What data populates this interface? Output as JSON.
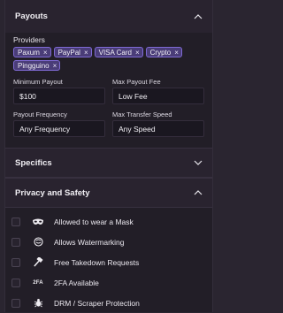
{
  "payouts": {
    "title": "Payouts",
    "providers_label": "Providers",
    "providers": [
      "Paxum",
      "PayPal",
      "VISA Card",
      "Crypto",
      "Pingguino"
    ],
    "remove_glyph": "×",
    "minimum_payout": {
      "label": "Minimum Payout",
      "value": "$100"
    },
    "max_payout_fee": {
      "label": "Max Payout Fee",
      "value": "Low Fee"
    },
    "payout_frequency": {
      "label": "Payout Frequency",
      "value": "Any Frequency"
    },
    "max_transfer_speed": {
      "label": "Max Transfer Speed",
      "value": "Any Speed"
    }
  },
  "specifics": {
    "title": "Specifics"
  },
  "privacy": {
    "title": "Privacy and Safety",
    "items": [
      {
        "label": "Allowed to wear a Mask",
        "icon": "mask-icon"
      },
      {
        "label": "Allows Watermarking",
        "icon": "watermark-icon"
      },
      {
        "label": "Free Takedown Requests",
        "icon": "hammer-icon"
      },
      {
        "label": "2FA Available",
        "icon": "two-factor-icon",
        "icon_text": "2FA"
      },
      {
        "label": "DRM / Scraper Protection",
        "icon": "bug-icon"
      }
    ]
  },
  "colors": {
    "chip_bg": "#4a3d78",
    "chip_border": "#7f6ad4",
    "panel_bg": "#221e27",
    "header_bg": "#29232f"
  }
}
